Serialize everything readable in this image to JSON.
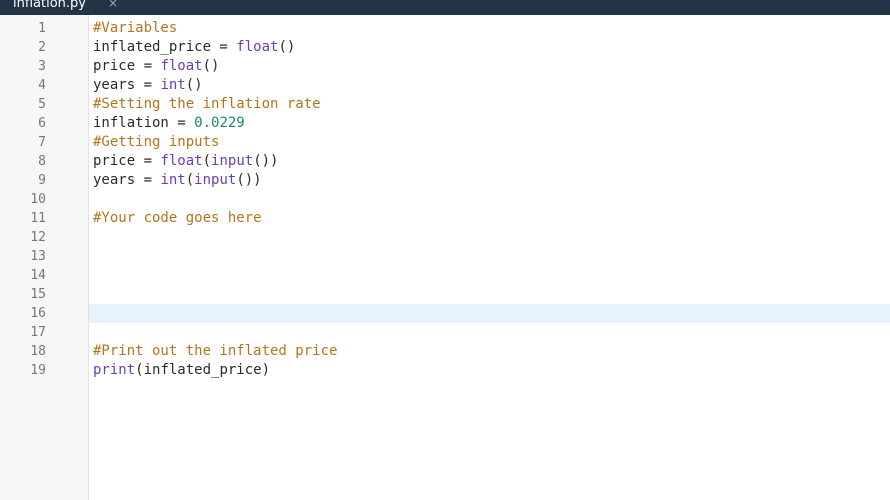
{
  "tab": {
    "filename": "inflation.py",
    "close_icon": "×"
  },
  "editor": {
    "line_numbers": [
      "1",
      "2",
      "3",
      "4",
      "5",
      "6",
      "7",
      "8",
      "9",
      "10",
      "11",
      "12",
      "13",
      "14",
      "15",
      "16",
      "17",
      "18",
      "19"
    ],
    "active_line": 16,
    "lines": [
      [
        {
          "t": "#Variables",
          "k": "comment"
        }
      ],
      [
        {
          "t": "inflated_price = ",
          "k": "plain"
        },
        {
          "t": "float",
          "k": "builtin"
        },
        {
          "t": "()",
          "k": "plain"
        }
      ],
      [
        {
          "t": "price = ",
          "k": "plain"
        },
        {
          "t": "float",
          "k": "builtin"
        },
        {
          "t": "()",
          "k": "plain"
        }
      ],
      [
        {
          "t": "years = ",
          "k": "plain"
        },
        {
          "t": "int",
          "k": "builtin"
        },
        {
          "t": "()",
          "k": "plain"
        }
      ],
      [
        {
          "t": "#Setting the inflation rate",
          "k": "comment"
        }
      ],
      [
        {
          "t": "inflation = ",
          "k": "plain"
        },
        {
          "t": "0.0229",
          "k": "number"
        }
      ],
      [
        {
          "t": "#Getting inputs",
          "k": "comment"
        }
      ],
      [
        {
          "t": "price = ",
          "k": "plain"
        },
        {
          "t": "float",
          "k": "builtin"
        },
        {
          "t": "(",
          "k": "plain"
        },
        {
          "t": "input",
          "k": "builtin"
        },
        {
          "t": "())",
          "k": "plain"
        }
      ],
      [
        {
          "t": "years = ",
          "k": "plain"
        },
        {
          "t": "int",
          "k": "builtin"
        },
        {
          "t": "(",
          "k": "plain"
        },
        {
          "t": "input",
          "k": "builtin"
        },
        {
          "t": "())",
          "k": "plain"
        }
      ],
      [],
      [
        {
          "t": "#Your code goes here",
          "k": "comment"
        }
      ],
      [],
      [],
      [],
      [],
      [],
      [],
      [
        {
          "t": "#Print out the inflated price",
          "k": "comment"
        }
      ],
      [
        {
          "t": "print",
          "k": "builtin"
        },
        {
          "t": "(inflated_price)",
          "k": "plain"
        }
      ]
    ]
  },
  "colors": {
    "tabbar_bg": "#243447",
    "comment": "#b4741c",
    "builtin": "#6a3fb5",
    "number": "#22866a",
    "active_line_bg": "#e8f2fe"
  }
}
